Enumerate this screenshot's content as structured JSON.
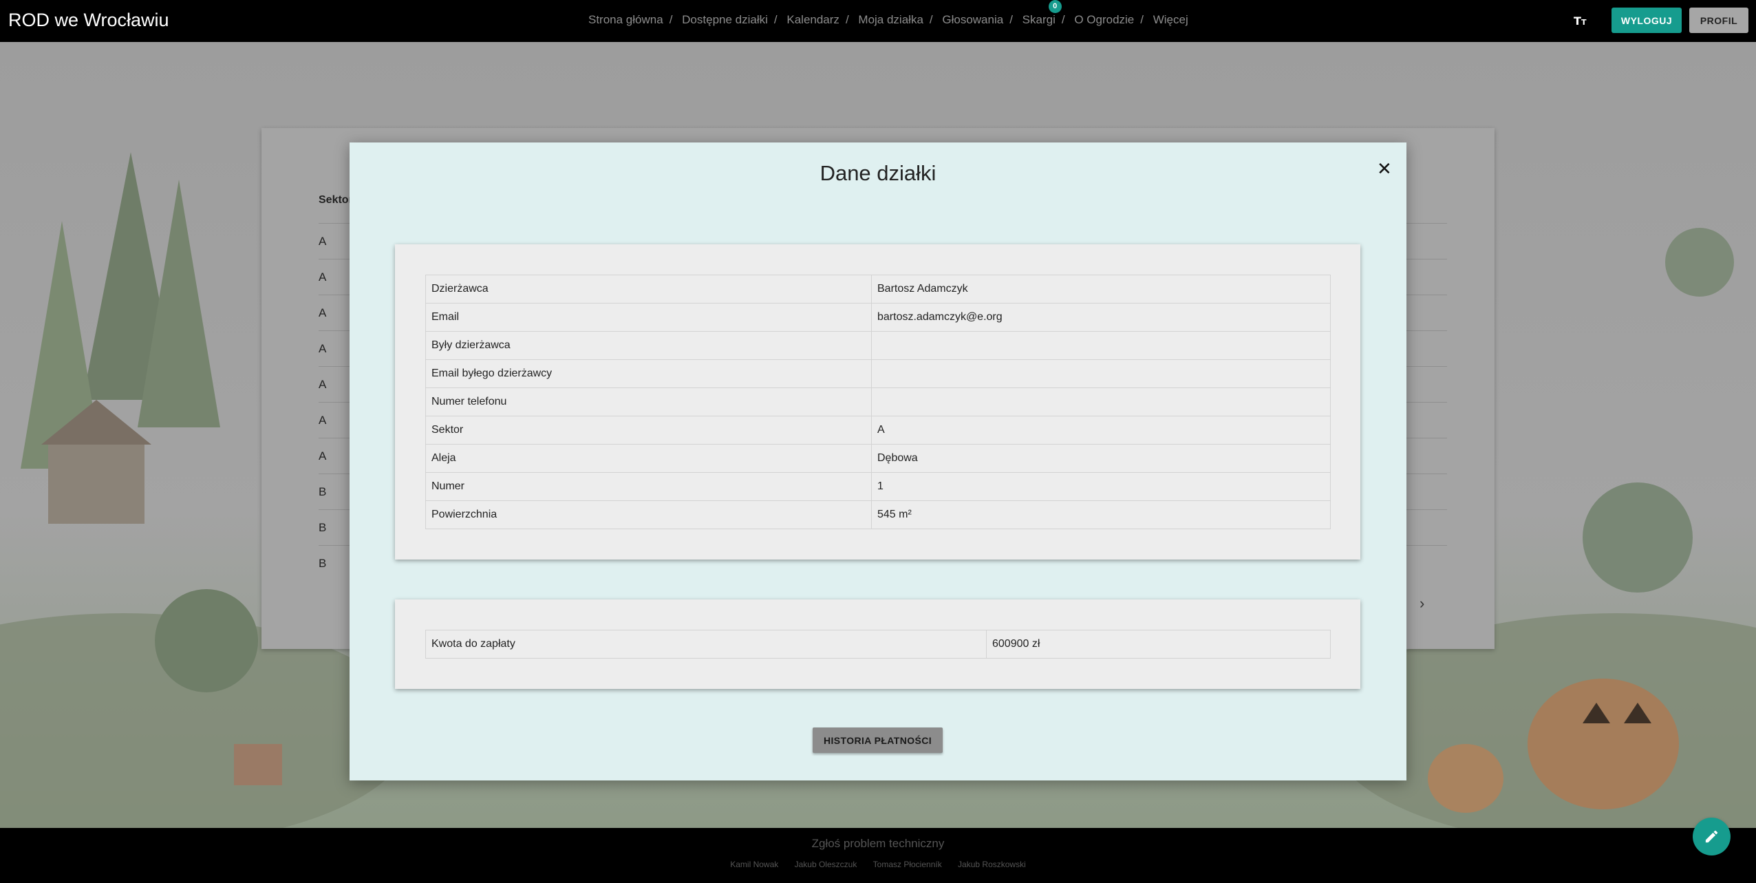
{
  "header": {
    "brand": "ROD we Wrocławiu",
    "nav": [
      "Strona główna",
      "Dostępne działki",
      "Kalendarz",
      "Moja działka",
      "Głosowania",
      "Skargi",
      "O Ogrodzie",
      "Więcej"
    ],
    "separator": "/",
    "skargi_badge": "0",
    "font_size_icon": "format-size-icon",
    "logout_label": "WYLOGUJ",
    "profile_label": "PROFIL"
  },
  "background_table": {
    "column_header": "Sektor",
    "rows": [
      "A",
      "A",
      "A",
      "A",
      "A",
      "A",
      "A",
      "B",
      "B",
      "B"
    ],
    "next_icon": "chevron-right-icon"
  },
  "modal": {
    "title": "Dane działki",
    "close_icon": "close-icon",
    "details": [
      {
        "label": "Dzierżawca",
        "value": "Bartosz Adamczyk"
      },
      {
        "label": "Email",
        "value": "bartosz.adamczyk@e.org"
      },
      {
        "label": "Były dzierżawca",
        "value": ""
      },
      {
        "label": "Email byłego dzierżawcy",
        "value": ""
      },
      {
        "label": "Numer telefonu",
        "value": ""
      },
      {
        "label": "Sektor",
        "value": "A"
      },
      {
        "label": "Aleja",
        "value": "Dębowa"
      },
      {
        "label": "Numer",
        "value": "1"
      },
      {
        "label": "Powierzchnia",
        "value": "545 m²"
      }
    ],
    "payment": {
      "label": "Kwota do zapłaty",
      "value": "600900 zł"
    },
    "history_button": "HISTORIA PŁATNOŚCI"
  },
  "footer": {
    "report_link": "Zgłoś problem techniczny",
    "authors": [
      "Kamil Nowak",
      "Jakub Oleszczuk",
      "Tomasz Płocienník",
      "Jakub Roszkowski"
    ]
  },
  "fab_icon": "pencil-icon",
  "colors": {
    "accent": "#169c8e",
    "modal_bg": "#dff0f0",
    "topbar": "#000000"
  }
}
